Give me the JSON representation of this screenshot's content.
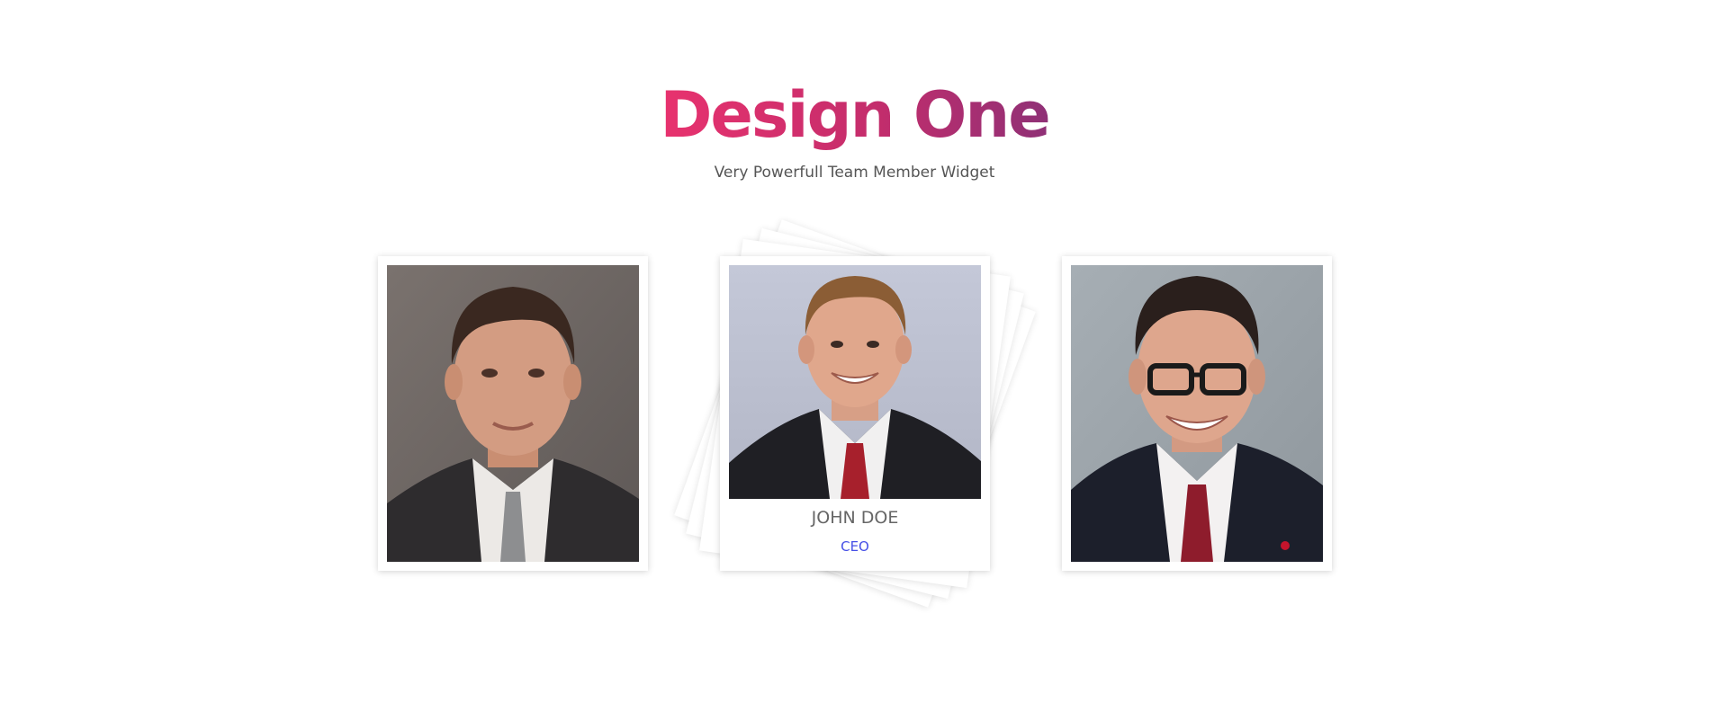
{
  "header": {
    "title": "Design One",
    "subtitle": "Very Powerfull Team Member Widget"
  },
  "members": [
    {
      "name": "",
      "role": ""
    },
    {
      "name": "JOHN DOE",
      "role": "CEO"
    },
    {
      "name": "",
      "role": ""
    }
  ],
  "colors": {
    "title_gradient_start": "#e8326e",
    "title_gradient_end": "#8f3076",
    "role_text": "#4650e6",
    "name_text": "#666666"
  }
}
